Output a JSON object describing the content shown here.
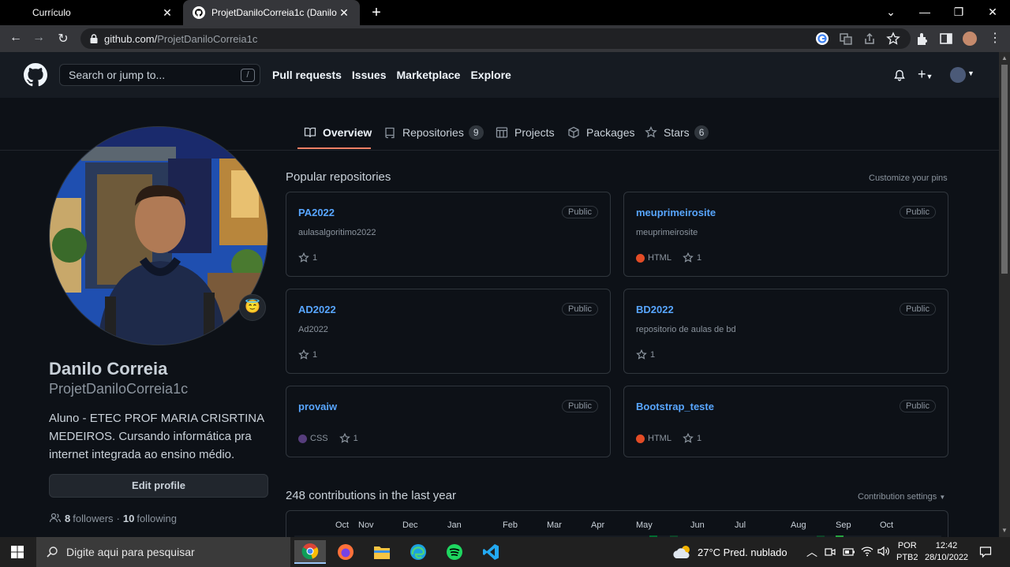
{
  "browser": {
    "tabs": [
      {
        "title": "Currículo"
      },
      {
        "title": "ProjetDaniloCorreia1c (Danilo Co"
      }
    ],
    "url_host": "github.com/",
    "url_path": "ProjetDaniloCorreia1c"
  },
  "header": {
    "search_placeholder": "Search or jump to...",
    "search_shortcut": "/",
    "nav": [
      "Pull requests",
      "Issues",
      "Marketplace",
      "Explore"
    ]
  },
  "profile_tabs": [
    {
      "label": "Overview",
      "icon": "book-icon"
    },
    {
      "label": "Repositories",
      "icon": "repo-icon",
      "count": "9"
    },
    {
      "label": "Projects",
      "icon": "project-icon"
    },
    {
      "label": "Packages",
      "icon": "package-icon"
    },
    {
      "label": "Stars",
      "icon": "star-icon",
      "count": "6"
    }
  ],
  "profile": {
    "name": "Danilo Correia",
    "login": "ProjetDaniloCorreia1c",
    "status_emoji": "😇",
    "bio": "Aluno - ETEC PROF MARIA CRISRTINA MEDEIROS. Cursando informática pra internet integrada ao ensino médio.",
    "edit_label": "Edit profile",
    "followers": "8",
    "followers_label": "followers",
    "separator": "·",
    "following": "10",
    "following_label": "following"
  },
  "popular": {
    "title": "Popular repositories",
    "customize": "Customize your pins",
    "repos": [
      {
        "name": "PA2022",
        "visibility": "Public",
        "description": "aulasalgoritimo2022",
        "language": "",
        "stars": "1"
      },
      {
        "name": "meuprimeirosite",
        "visibility": "Public",
        "description": "meuprimeirosite",
        "language": "HTML",
        "lang_color": "#e34c26",
        "stars": "1"
      },
      {
        "name": "AD2022",
        "visibility": "Public",
        "description": "Ad2022",
        "language": "",
        "stars": "1"
      },
      {
        "name": "BD2022",
        "visibility": "Public",
        "description": "repositorio de aulas de bd",
        "language": "",
        "stars": "1"
      },
      {
        "name": "provaiw",
        "visibility": "Public",
        "description": "",
        "language": "CSS",
        "lang_color": "#563d7c",
        "stars": "1"
      },
      {
        "name": "Bootstrap_teste",
        "visibility": "Public",
        "description": "",
        "language": "HTML",
        "lang_color": "#e34c26",
        "stars": "1"
      }
    ]
  },
  "contributions": {
    "title": "248 contributions in the last year",
    "settings": "Contribution settings",
    "months": [
      "Oct",
      "Nov",
      "Dec",
      "Jan",
      "Feb",
      "Mar",
      "Apr",
      "May",
      "Jun",
      "Jul",
      "Aug",
      "Sep",
      "Oct"
    ]
  },
  "taskbar": {
    "search_placeholder": "Digite aqui para pesquisar",
    "weather": "27°C  Pred. nublado",
    "lang1": "POR",
    "lang2": "PTB2",
    "time": "12:42",
    "date": "28/10/2022"
  },
  "colors": {
    "accent_link": "#58a6ff",
    "tab_underline": "#f78166",
    "background": "#0d1117"
  }
}
